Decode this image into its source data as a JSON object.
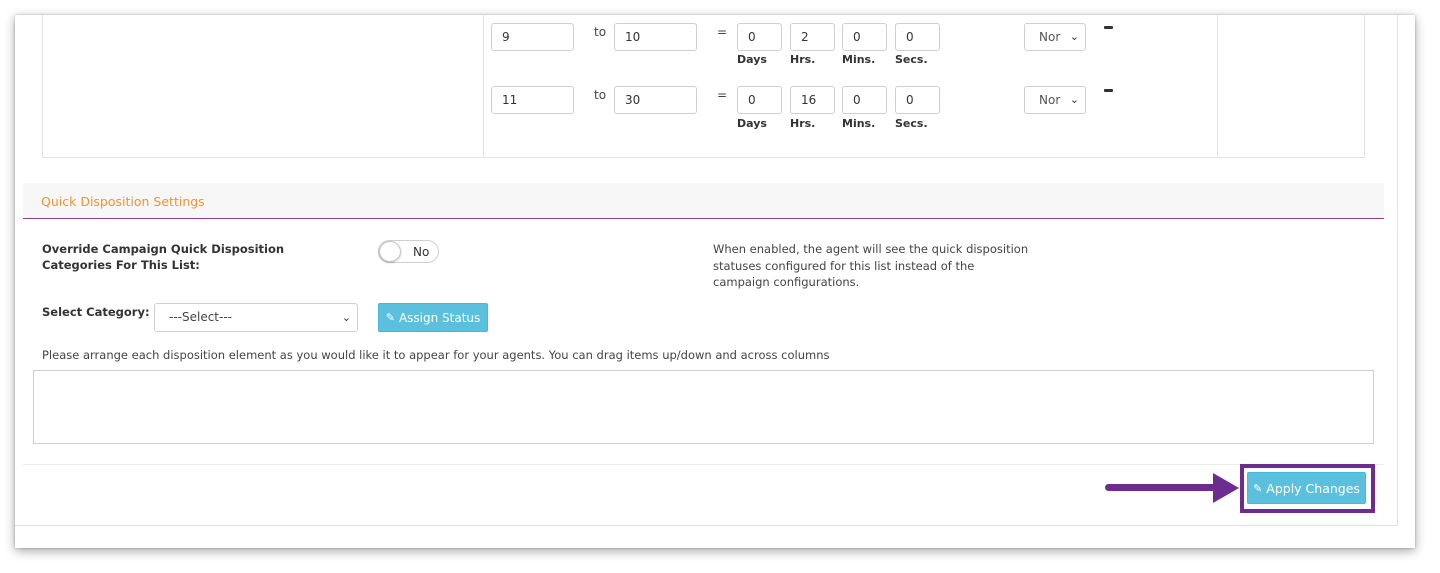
{
  "ranges": [
    {
      "from": "9",
      "to_label": "to",
      "to": "10",
      "eq": "=",
      "days": "0",
      "hrs": "2",
      "mins": "0",
      "secs": "0",
      "status": "Nor"
    },
    {
      "from": "11",
      "to_label": "to",
      "to": "30",
      "eq": "=",
      "days": "0",
      "hrs": "16",
      "mins": "0",
      "secs": "0",
      "status": "Nor"
    }
  ],
  "units": {
    "days": "Days",
    "hrs": "Hrs.",
    "mins": "Mins.",
    "secs": "Secs."
  },
  "section": {
    "title": "Quick Disposition Settings"
  },
  "override": {
    "label": "Override Campaign Quick Disposition Categories For This List:",
    "toggle_value": "No",
    "help": "When enabled, the agent will see the quick disposition statuses configured for this list instead of the campaign configurations."
  },
  "category": {
    "label": "Select Category:",
    "selected": "---Select---",
    "assign_label": "Assign Status"
  },
  "arrange_text": "Please arrange each disposition element as you would like it to appear for your agents. You can drag items up/down and across columns",
  "footer": {
    "apply_label": "Apply Changes"
  },
  "icons": {
    "edit": "edit-icon",
    "chevron": "chevron-down-icon",
    "minus": "minus-icon"
  },
  "colors": {
    "accent_orange": "#f0932b",
    "section_rule": "#8e3d96",
    "button_info": "#5bc0de",
    "annotation_purple": "#6c2d8f"
  }
}
